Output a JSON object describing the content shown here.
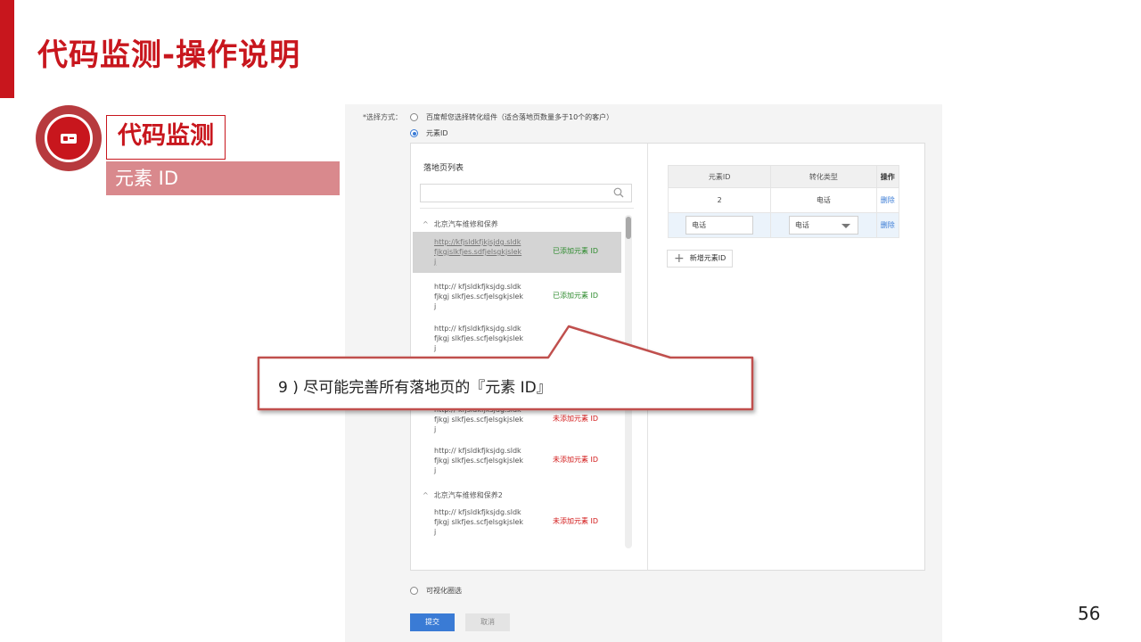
{
  "slide": {
    "title": "代码监测-操作说明",
    "section_name": "代码监测",
    "section_subtitle": "元素 ID",
    "page_number": "56",
    "accent_color": "#c8161d"
  },
  "form": {
    "method_label": "*选择方式：",
    "option_auto": "百度帮您选择转化组件（适合落地页数量多于10个的客户）",
    "option_element_id": "元素ID",
    "option_visual": "可视化圈选",
    "submit_label": "提交",
    "cancel_label": "取消"
  },
  "landing_list": {
    "title": "落地页列表",
    "search_placeholder": "",
    "groups": [
      {
        "name": "北京汽车维修和保养",
        "items": [
          {
            "url": "http://kfjsldkfjkjsjdg.sldkfjkgjslkfjes.sdfjelsgkjslekj",
            "status": "已添加元素 ID",
            "added": true
          },
          {
            "url": "http:// kfjsldkfjksjdg.sldkfjkgj slkfjes.scfjelsgkjslekj",
            "status": "已添加元素 ID",
            "added": true
          },
          {
            "url": "http:// kfjsldkfjksjdg.sldkfjkgj slkfjes.scfjelsgkjslekj",
            "status": "",
            "added": false
          },
          {
            "url": "http:// kfjsldkfjksjdg.sldkfjkgj slkfjes.scfjelsgkjslekj",
            "status": "未添加元素 ID",
            "added": false
          },
          {
            "url": "http:// kfjsldkfjksjdg.sldkfjkgj slkfjes.scfjelsgkjslekj",
            "status": "未添加元素 ID",
            "added": false
          }
        ]
      },
      {
        "name": "北京汽车维修和保养2",
        "items": [
          {
            "url": "http:// kfjsldkfjksjdg.sldkfjkgj slkfjes.scfjelsgkjslekj",
            "status": "未添加元素 ID",
            "added": false
          }
        ]
      }
    ]
  },
  "id_table": {
    "headers": [
      "元素ID",
      "转化类型",
      "操作"
    ],
    "rows": [
      {
        "element_id": "2",
        "conversion_type": "电话",
        "action": "删除"
      }
    ],
    "edit_row": {
      "input_value": "电话",
      "select_value": "电话",
      "action": "删除"
    },
    "add_button_label": "新增元素ID"
  },
  "callout": {
    "text": "9 ) 尽可能完善所有落地页的『元素 ID』"
  }
}
